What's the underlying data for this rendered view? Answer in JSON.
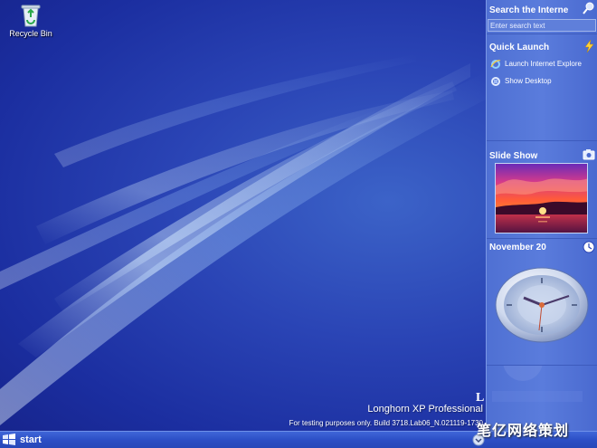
{
  "desktop": {
    "icons": [
      {
        "label": "Recycle Bin",
        "icon": "recycle-bin-icon"
      }
    ],
    "brand": {
      "title": "Longhorn XP Professional",
      "note": "For testing purposes only. Build 3718.Lab06_N.021119-1730",
      "partial_letter": "L"
    }
  },
  "sidebar": {
    "search": {
      "title": "Search the Interne",
      "placeholder": "Enter search text",
      "icon": "magnifier-icon"
    },
    "quick_launch": {
      "title": "Quick Launch",
      "icon": "lightning-icon",
      "items": [
        {
          "label": "Launch Internet Explore",
          "icon": "internet-explorer-icon"
        },
        {
          "label": "Show Desktop",
          "icon": "show-desktop-icon"
        }
      ]
    },
    "slideshow": {
      "title": "Slide Show",
      "icon": "camera-icon",
      "image": "sunset-over-water-photo"
    },
    "clock": {
      "title": "November 20",
      "icon": "clock-icon"
    }
  },
  "taskbar": {
    "start_label": "start"
  },
  "watermark": {
    "text": "笔亿网络策划"
  },
  "colors": {
    "desktop_blue": "#2a44b5",
    "sidebar_blue": "#5a7cdc",
    "taskbar_blue": "#2c4fc6"
  }
}
